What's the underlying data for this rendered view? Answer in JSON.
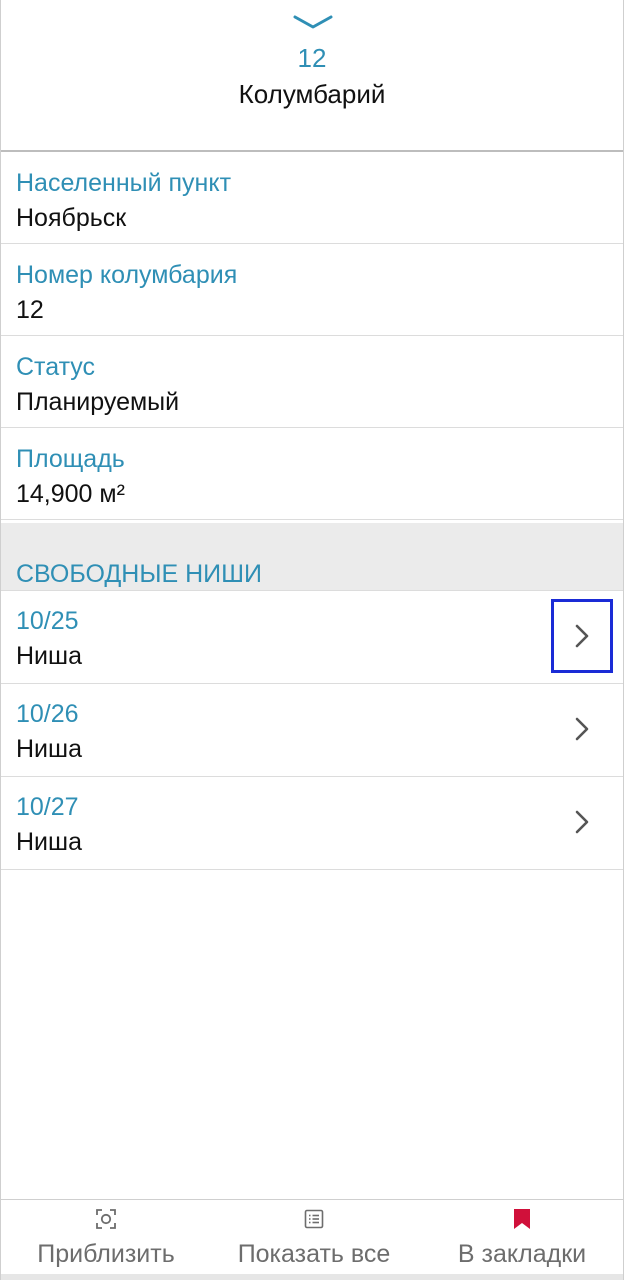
{
  "header": {
    "number": "12",
    "title": "Колумбарий"
  },
  "info": [
    {
      "label": "Населенный пункт",
      "value": "Ноябрьск"
    },
    {
      "label": "Номер колумбария",
      "value": "12"
    },
    {
      "label": "Статус",
      "value": "Планируемый"
    },
    {
      "label": "Площадь",
      "value": "14,900 м²"
    }
  ],
  "section": {
    "title": "СВОБОДНЫЕ НИШИ"
  },
  "niches": [
    {
      "number": "10/25",
      "type": "Ниша"
    },
    {
      "number": "10/26",
      "type": "Ниша"
    },
    {
      "number": "10/27",
      "type": "Ниша"
    }
  ],
  "bottom_bar": {
    "zoom_label": "Приблизить",
    "show_all_label": "Показать все",
    "bookmark_label": "В закладки"
  },
  "colors": {
    "accent": "#2f8fb5",
    "bookmark": "#d0103a",
    "focus_outline": "#1a2bd6"
  },
  "icons": {
    "collapse": "chevron-down-icon",
    "zoom": "focus-icon",
    "show_all": "list-icon",
    "bookmark": "bookmark-icon",
    "row_action": "chevron-right-icon"
  }
}
